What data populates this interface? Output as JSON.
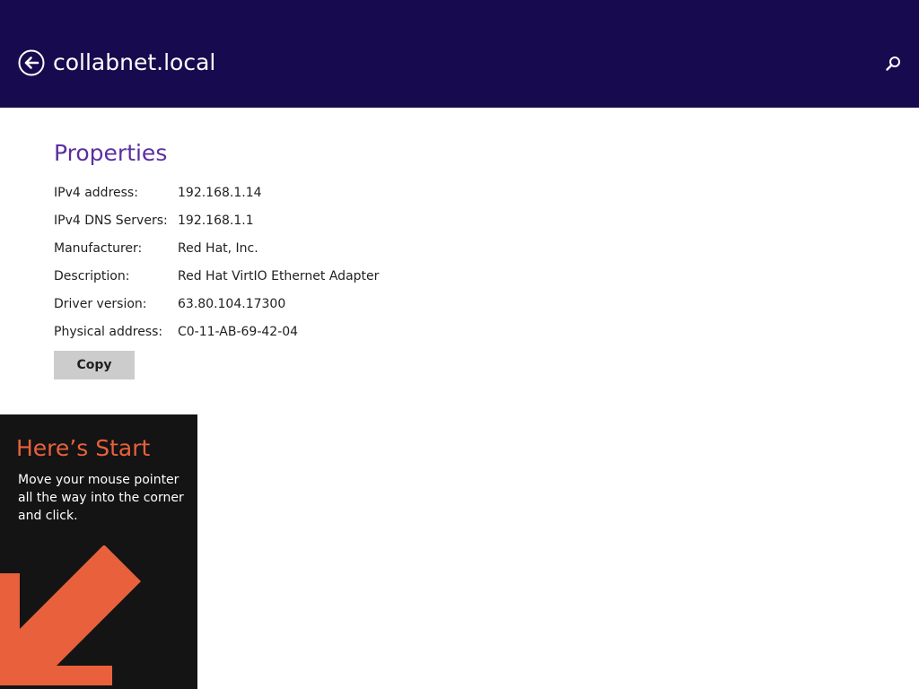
{
  "header": {
    "title": "collabnet.local",
    "back_icon": "back-arrow-icon",
    "search_icon": "search-icon",
    "background_color": "#180a4e"
  },
  "properties": {
    "title": "Properties",
    "rows": [
      {
        "label": "IPv4 address:",
        "value": "192.168.1.14"
      },
      {
        "label": "IPv4 DNS Servers:",
        "value": "192.168.1.1"
      },
      {
        "label": "Manufacturer:",
        "value": "Red Hat, Inc."
      },
      {
        "label": "Description:",
        "value": "Red Hat VirtIO Ethernet Adapter"
      },
      {
        "label": "Driver version:",
        "value": "63.80.104.17300"
      },
      {
        "label": "Physical address:",
        "value": "C0-11-AB-69-42-04"
      }
    ],
    "copy_label": "Copy",
    "title_color": "#5b2f9f"
  },
  "tip": {
    "title": "Here’s Start",
    "body": "Move your mouse pointer all the way into the corner and click.",
    "arrow_icon": "arrow-down-left-icon",
    "accent_color": "#e8613c"
  }
}
